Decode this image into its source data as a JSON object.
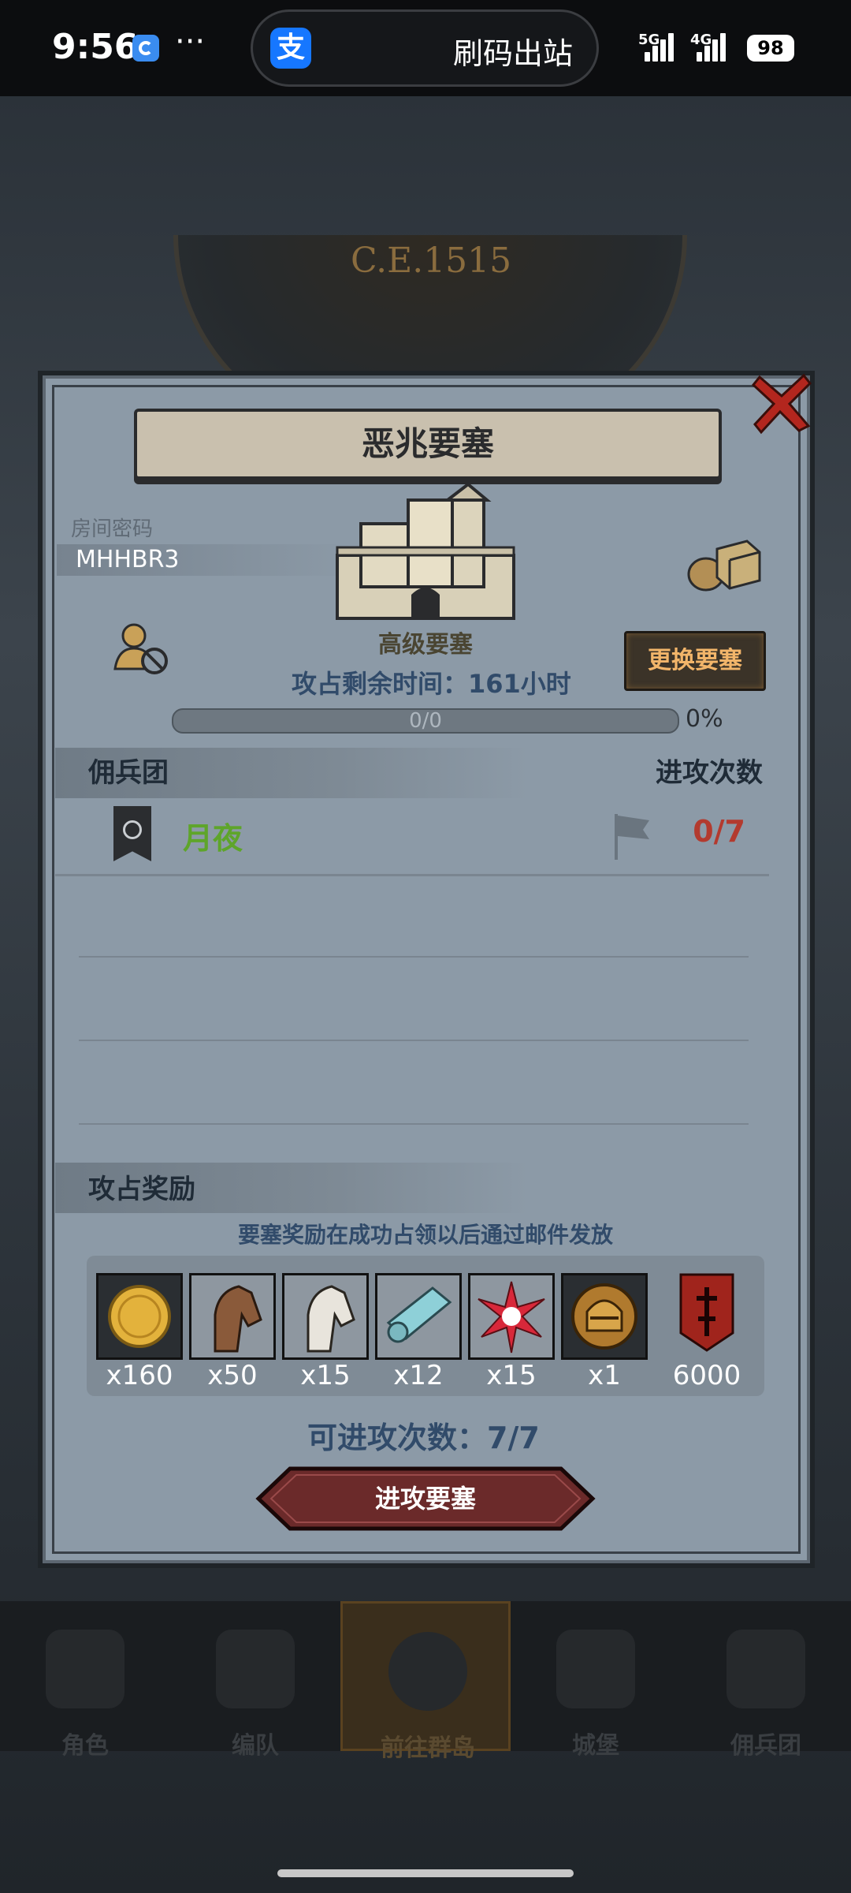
{
  "status_bar": {
    "time": "9:56",
    "more": "···",
    "pill_app": "支",
    "pill_text": "刷码出站",
    "signal_1": "5G",
    "signal_2": "4G",
    "battery": "98"
  },
  "background": {
    "era": "C.E.1515"
  },
  "dialog": {
    "title": "恶兆要塞",
    "room_label": "房间密码",
    "room_code": "MHHBR3",
    "fortress_level": "高级要塞",
    "change_button": "更换要塞",
    "time_label": "攻占剩余时间：161小时",
    "progress": {
      "text": "0/0",
      "fraction": 0.0,
      "percent_label": "0%"
    },
    "guild_section": {
      "title": "佣兵团",
      "attacks_header": "进攻次数",
      "rows": [
        {
          "name": "月夜",
          "count": "0/7"
        }
      ]
    },
    "reward_section": {
      "title": "攻占奖励",
      "note": "要塞奖励在成功占领以后通过邮件发放",
      "items": [
        {
          "icon": "gold-coin-icon",
          "qty": "x160"
        },
        {
          "icon": "brown-horse-icon",
          "qty": "x50"
        },
        {
          "icon": "white-horse-icon",
          "qty": "x15"
        },
        {
          "icon": "cloth-scroll-icon",
          "qty": "x12"
        },
        {
          "icon": "red-star-icon",
          "qty": "x15"
        },
        {
          "icon": "knight-helmet-coin-icon",
          "qty": "x1"
        },
        {
          "icon": "guild-banner-icon",
          "qty": "6000"
        }
      ]
    },
    "attacks_available": "可进攻次数：7/7",
    "attack_button": "进攻要塞"
  },
  "bottom_nav": [
    {
      "label": "角色"
    },
    {
      "label": "编队"
    },
    {
      "label": "前往群岛"
    },
    {
      "label": "城堡"
    },
    {
      "label": "佣兵团"
    }
  ],
  "colors": {
    "accent_gold": "#c9a158",
    "guild_green": "#5ea52a",
    "count_red": "#b33a2e",
    "attack_button": "#6b2a2a"
  }
}
